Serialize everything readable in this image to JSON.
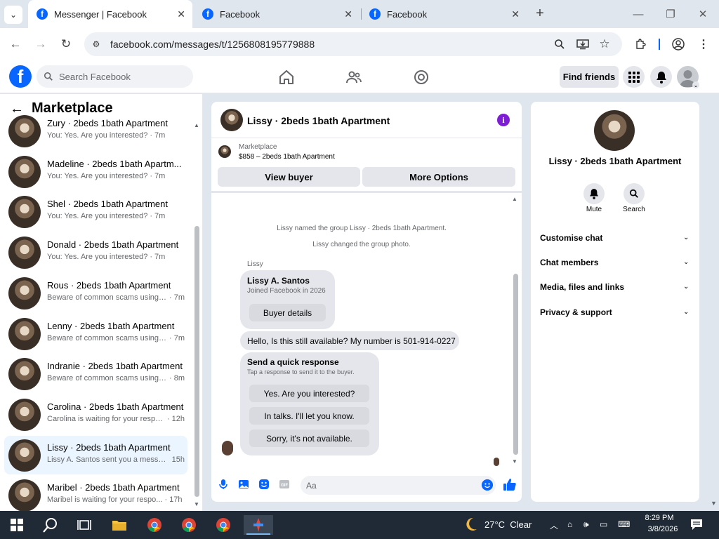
{
  "browser": {
    "tabs": [
      {
        "label": "Messenger | Facebook",
        "icon": "facebook-icon"
      },
      {
        "label": "Facebook",
        "icon": "facebook-icon"
      },
      {
        "label": "Facebook",
        "icon": "facebook-icon"
      }
    ],
    "url": "facebook.com/messages/t/1256808195779888"
  },
  "fb_header": {
    "search_placeholder": "Search Facebook",
    "find_friends": "Find friends"
  },
  "left_panel": {
    "title": "Marketplace",
    "conversations": [
      {
        "name": "Zury · 2beds 1bath Apartment",
        "preview": "You: Yes. Are you interested?",
        "time": "· 7m",
        "selected": false
      },
      {
        "name": "Madeline · 2beds 1bath Apartm...",
        "preview": "You: Yes. Are you interested?",
        "time": "· 7m",
        "selected": false
      },
      {
        "name": "Shel · 2beds 1bath Apartment",
        "preview": "You: Yes. Are you interested?",
        "time": "· 7m",
        "selected": false
      },
      {
        "name": "Donald · 2beds 1bath Apartment",
        "preview": "You: Yes. Are you interested?",
        "time": "· 7m",
        "selected": false
      },
      {
        "name": "Rous · 2beds 1bath Apartment",
        "preview": "Beware of common scams using ...",
        "time": "· 7m",
        "selected": false
      },
      {
        "name": "Lenny · 2beds 1bath Apartment",
        "preview": "Beware of common scams using ...",
        "time": "· 7m",
        "selected": false
      },
      {
        "name": "Indranie · 2beds 1bath Apartment",
        "preview": "Beware of common scams using ...",
        "time": "· 8m",
        "selected": false
      },
      {
        "name": "Carolina · 2beds 1bath Apartment",
        "preview": "Carolina is waiting for your respo...",
        "time": "· 12h",
        "selected": false
      },
      {
        "name": "Lissy · 2beds 1bath Apartment",
        "preview": "Lissy A. Santos sent you a messag...",
        "time": "15h",
        "selected": true
      },
      {
        "name": "Maribel · 2beds 1bath Apartment",
        "preview": "Maribel is waiting for your respo...",
        "time": "· 17h",
        "selected": false
      }
    ]
  },
  "chat": {
    "title": "Lissy · 2beds 1bath Apartment",
    "marketplace_label": "Marketplace",
    "listing": "$858 – 2beds 1bath Apartment",
    "view_buyer": "View buyer",
    "more_options": "More Options",
    "system_messages": [
      "Lissy named the group Lissy · 2beds 1bath Apartment.",
      "Lissy changed the group photo."
    ],
    "sender_name": "Lissy",
    "buyer_card": {
      "name": "Lissy A. Santos",
      "joined": "Joined Facebook in 2026",
      "button": "Buyer details"
    },
    "message": "Hello, Is this still available? My number is 501-914-0227",
    "quick_response": {
      "title": "Send a quick response",
      "subtitle": "Tap a response to send it to the buyer.",
      "options": [
        "Yes. Are you interested?",
        "In talks. I'll let you know.",
        "Sorry, it's not available."
      ]
    },
    "composer_placeholder": "Aa"
  },
  "right_panel": {
    "name": "Lissy · 2beds 1bath Apartment",
    "mute": "Mute",
    "search": "Search",
    "sections": [
      "Customise chat",
      "Chat members",
      "Media, files and links",
      "Privacy & support"
    ]
  },
  "taskbar": {
    "temperature": "27°C",
    "weather": "Clear",
    "time": "8:29 PM",
    "date": "3/8/2026"
  },
  "colors": {
    "accent": "#0866ff",
    "info_purple": "#7e1fd6",
    "selected_row": "#ebf5ff"
  }
}
